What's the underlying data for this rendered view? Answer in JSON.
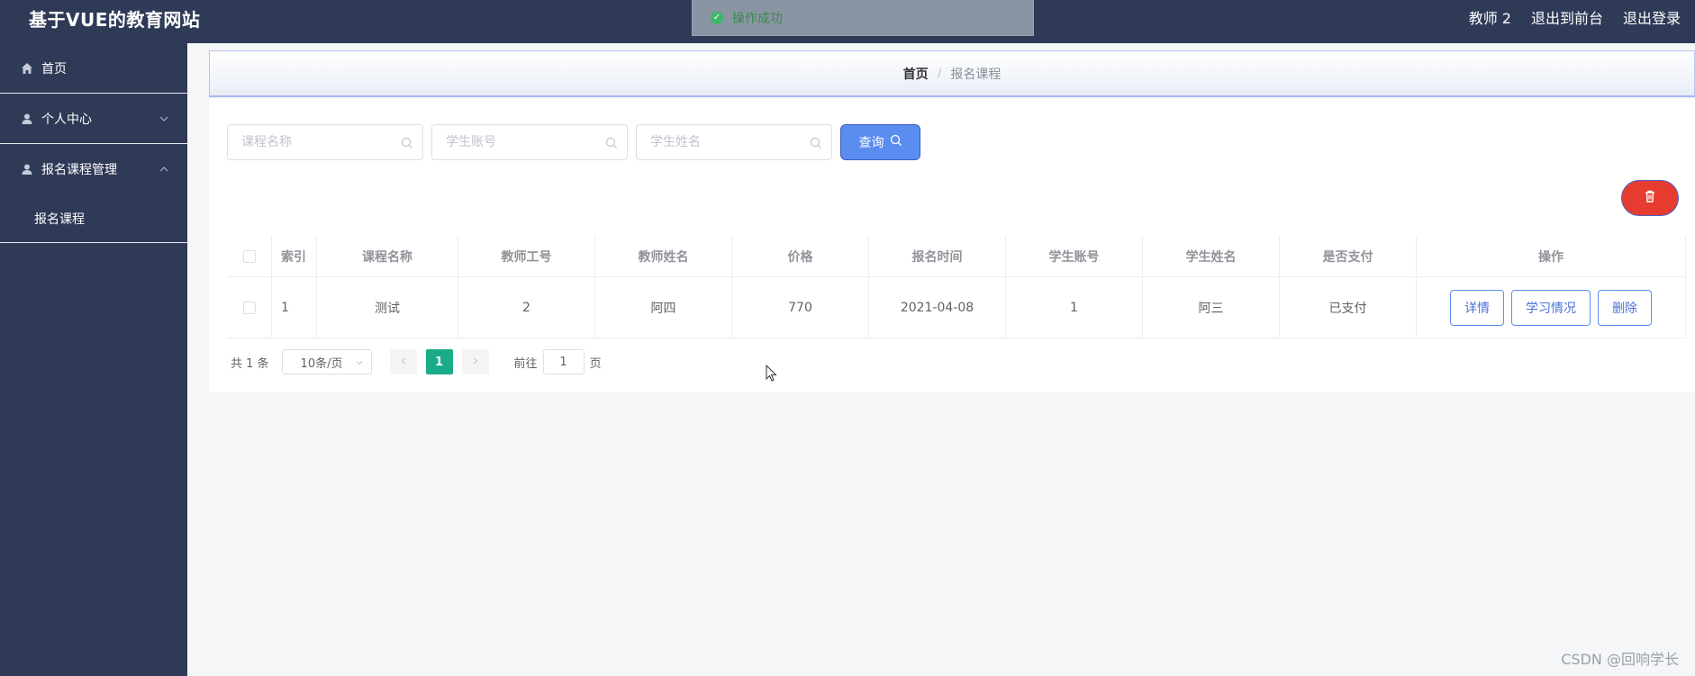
{
  "header": {
    "brand": "基于VUE的教育网站",
    "user": "教师 2",
    "links": [
      "退出到前台",
      "退出登录"
    ]
  },
  "toast": {
    "text": "操作成功",
    "icon": "success-check-icon"
  },
  "sidebar": {
    "items": [
      {
        "label": "首页",
        "icon": "home-icon"
      },
      {
        "label": "个人中心",
        "icon": "user-icon",
        "expanded": false
      },
      {
        "label": "报名课程管理",
        "icon": "user-icon",
        "expanded": true
      }
    ],
    "submenu": [
      "报名课程"
    ]
  },
  "breadcrumb": {
    "home": "首页",
    "separator": "/",
    "current": "报名课程"
  },
  "search": {
    "placeholders": [
      "课程名称",
      "学生账号",
      "学生姓名"
    ],
    "button_label": "查询"
  },
  "table": {
    "columns": [
      "索引",
      "课程名称",
      "教师工号",
      "教师姓名",
      "价格",
      "报名时间",
      "学生账号",
      "学生姓名",
      "是否支付",
      "操作"
    ],
    "rows": [
      {
        "index": "1",
        "course": "测试",
        "teacher_id": "2",
        "teacher_name": "阿四",
        "price": "770",
        "date": "2021-04-08",
        "student_account": "1",
        "student_name": "阿三",
        "paid": "已支付"
      }
    ],
    "actions": [
      "详情",
      "学习情况",
      "删除"
    ]
  },
  "pagination": {
    "total": "共 1 条",
    "page_size": "10条/页",
    "current_page": "1",
    "goto_label": "前往",
    "goto_value": "1",
    "page_suffix": "页"
  },
  "watermark": "CSDN @回响学长",
  "colors": {
    "sidebar_bg": "#2f3a57",
    "primary": "#5b8df0",
    "danger": "#e63c30",
    "page_active": "#1aab8a"
  }
}
